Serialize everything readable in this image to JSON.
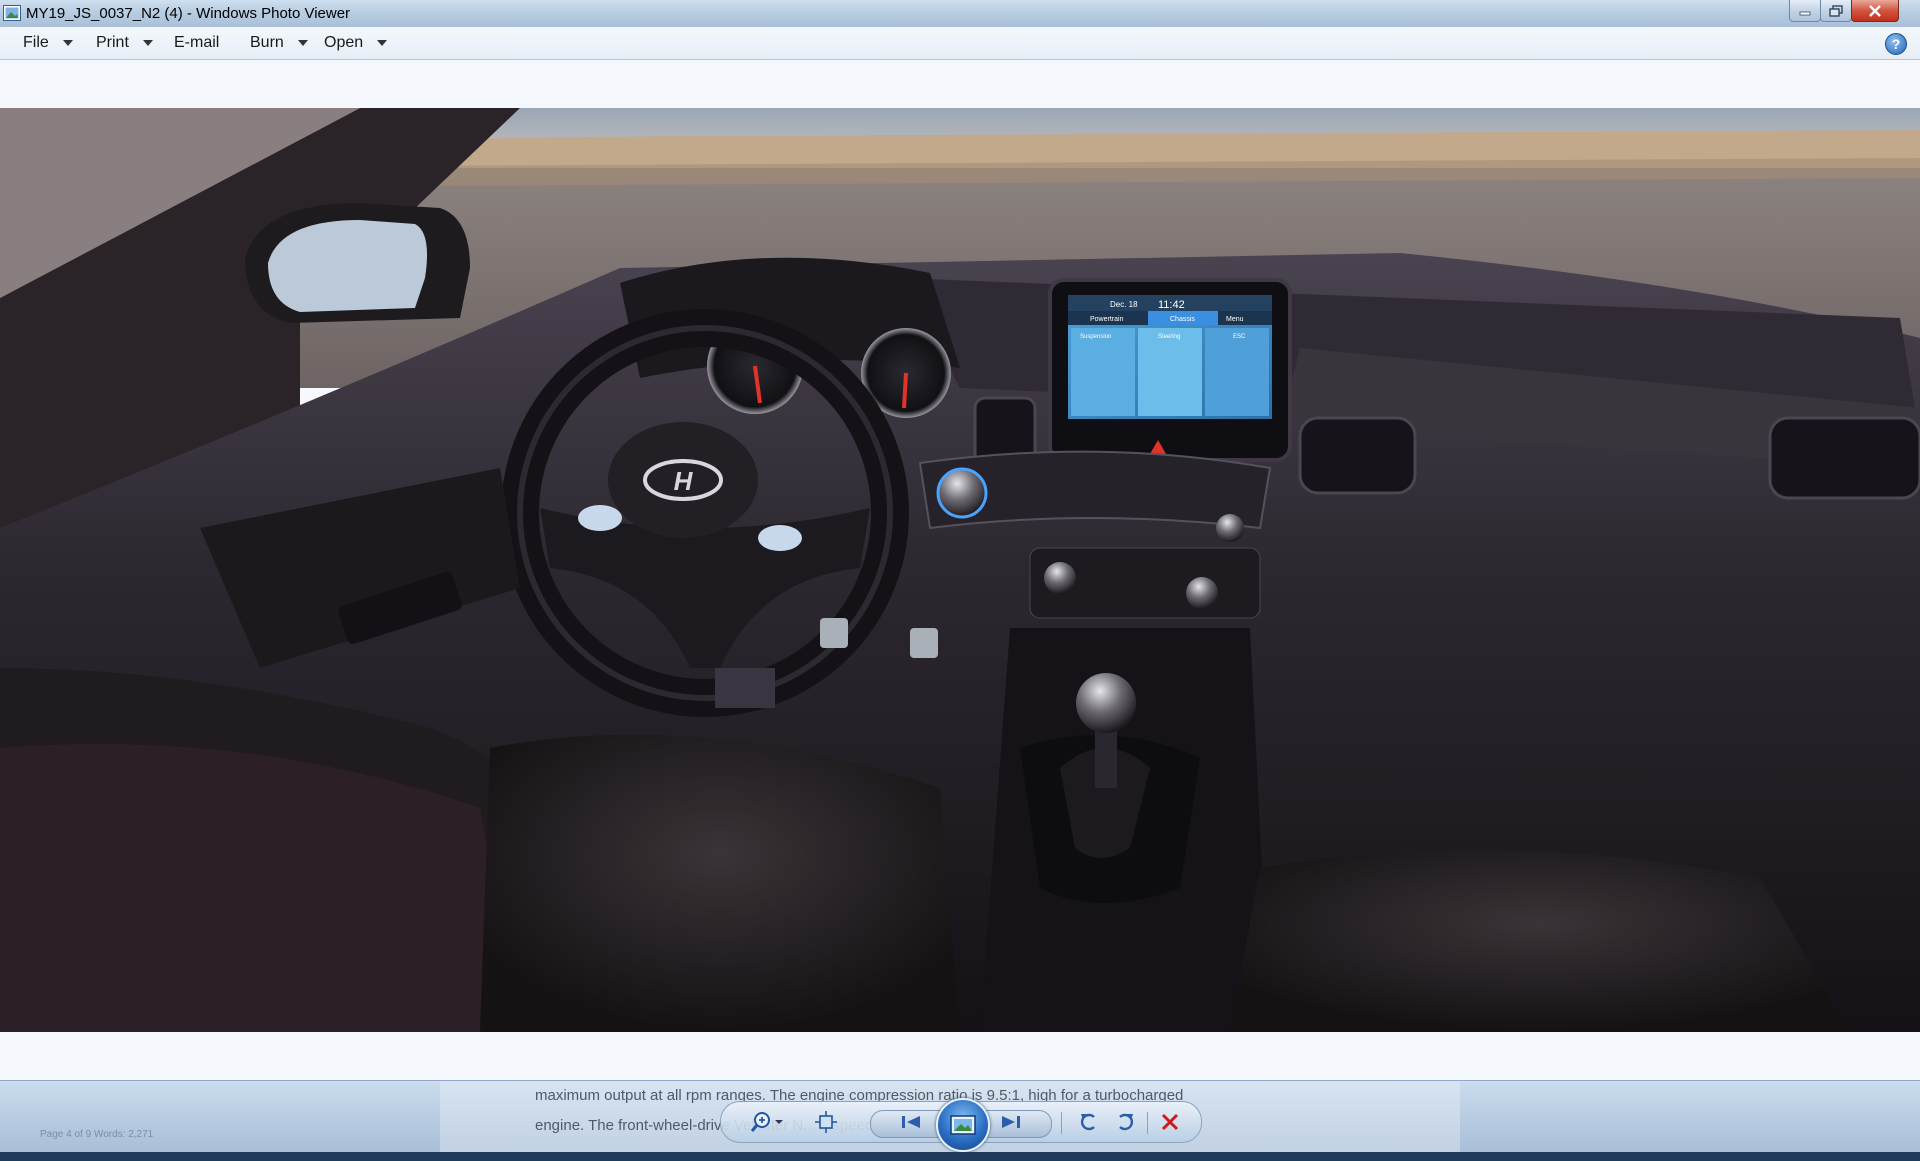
{
  "window": {
    "title": "MY19_JS_0037_N2 (4) - Windows Photo Viewer",
    "icon": "photo-viewer-icon",
    "buttons": [
      "minimize-icon",
      "maximize-icon",
      "close-icon"
    ]
  },
  "menu": {
    "items": [
      {
        "label": "File",
        "has_dropdown": true
      },
      {
        "label": "Print",
        "has_dropdown": true
      },
      {
        "label": "E-mail",
        "has_dropdown": false
      },
      {
        "label": "Burn",
        "has_dropdown": true
      },
      {
        "label": "Open",
        "has_dropdown": true
      }
    ],
    "help_label": "?"
  },
  "photo": {
    "description_icon": "car-interior-photo",
    "screen_texts": {
      "date": "Dec. 18",
      "time": "11:42",
      "tab_left": "Powertrain",
      "tab_active": "Chassis",
      "menu": "Menu",
      "panel_1": "Suspension",
      "panel_2": "Steering",
      "panel_3": "ESC"
    }
  },
  "background_document": {
    "line1": "maximum output at all rpm ranges. The engine compression ratio is 9.5:1, high for a turbocharged",
    "line2": "engine. The front-wheel-drive Veloster N... ...speed manual",
    "status": "Page 4 of 9    Words: 2,271"
  },
  "controls": {
    "zoom": "zoom-icon",
    "actual_size": "fit-to-window-icon",
    "previous": "previous-icon",
    "slideshow": "slideshow-icon",
    "next": "next-icon",
    "rotate_ccw": "rotate-counterclockwise-icon",
    "rotate_cw": "rotate-clockwise-icon",
    "delete": "delete-icon"
  },
  "colors": {
    "titlebar": "#b8cde2",
    "close_button": "#c1301a",
    "slideshow_button": "#2b6fc4",
    "delete_icon": "#d01a1a"
  }
}
